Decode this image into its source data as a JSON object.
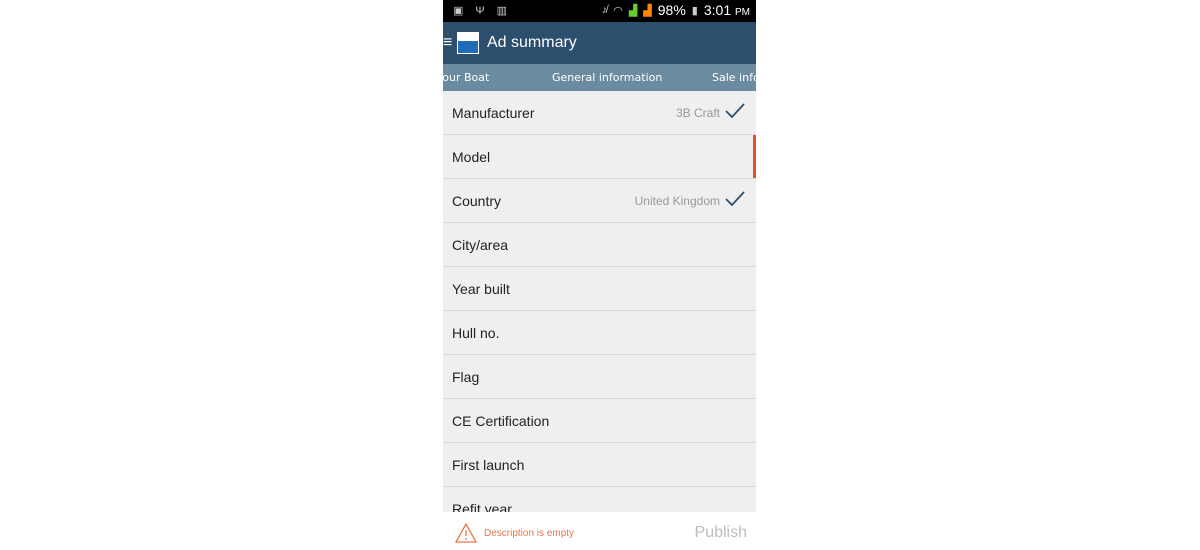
{
  "status_bar": {
    "battery": "98%",
    "time": "3:01",
    "ampm": "PM",
    "icons_left": [
      "image-icon",
      "usb-icon",
      "barcode-icon"
    ],
    "icons_right": [
      "mute-icon",
      "wifi-icon",
      "signal-icon",
      "signal-icon-2",
      "battery-charging-icon"
    ]
  },
  "app_bar": {
    "title": "Ad summary"
  },
  "tabs": [
    {
      "label": "Your Boat"
    },
    {
      "label": "General information",
      "active": true
    },
    {
      "label": "Sale information"
    }
  ],
  "fields": [
    {
      "label": "Manufacturer",
      "value": "3B Craft",
      "complete": true
    },
    {
      "label": "Model",
      "value": "",
      "required": true
    },
    {
      "label": "Country",
      "value": "United Kingdom",
      "complete": true
    },
    {
      "label": "City/area",
      "value": ""
    },
    {
      "label": "Year built",
      "value": ""
    },
    {
      "label": "Hull no.",
      "value": ""
    },
    {
      "label": "Flag",
      "value": ""
    },
    {
      "label": "CE Certification",
      "value": ""
    },
    {
      "label": "First launch",
      "value": ""
    },
    {
      "label": "Refit year",
      "value": ""
    }
  ],
  "footer": {
    "warning": "Description is empty",
    "publish_label": "Publish"
  },
  "colors": {
    "app_bar": "#2c4f6e",
    "tab_bar": "#6b8ba0",
    "warning": "#e8764a",
    "required_indicator": "#e0532c"
  }
}
